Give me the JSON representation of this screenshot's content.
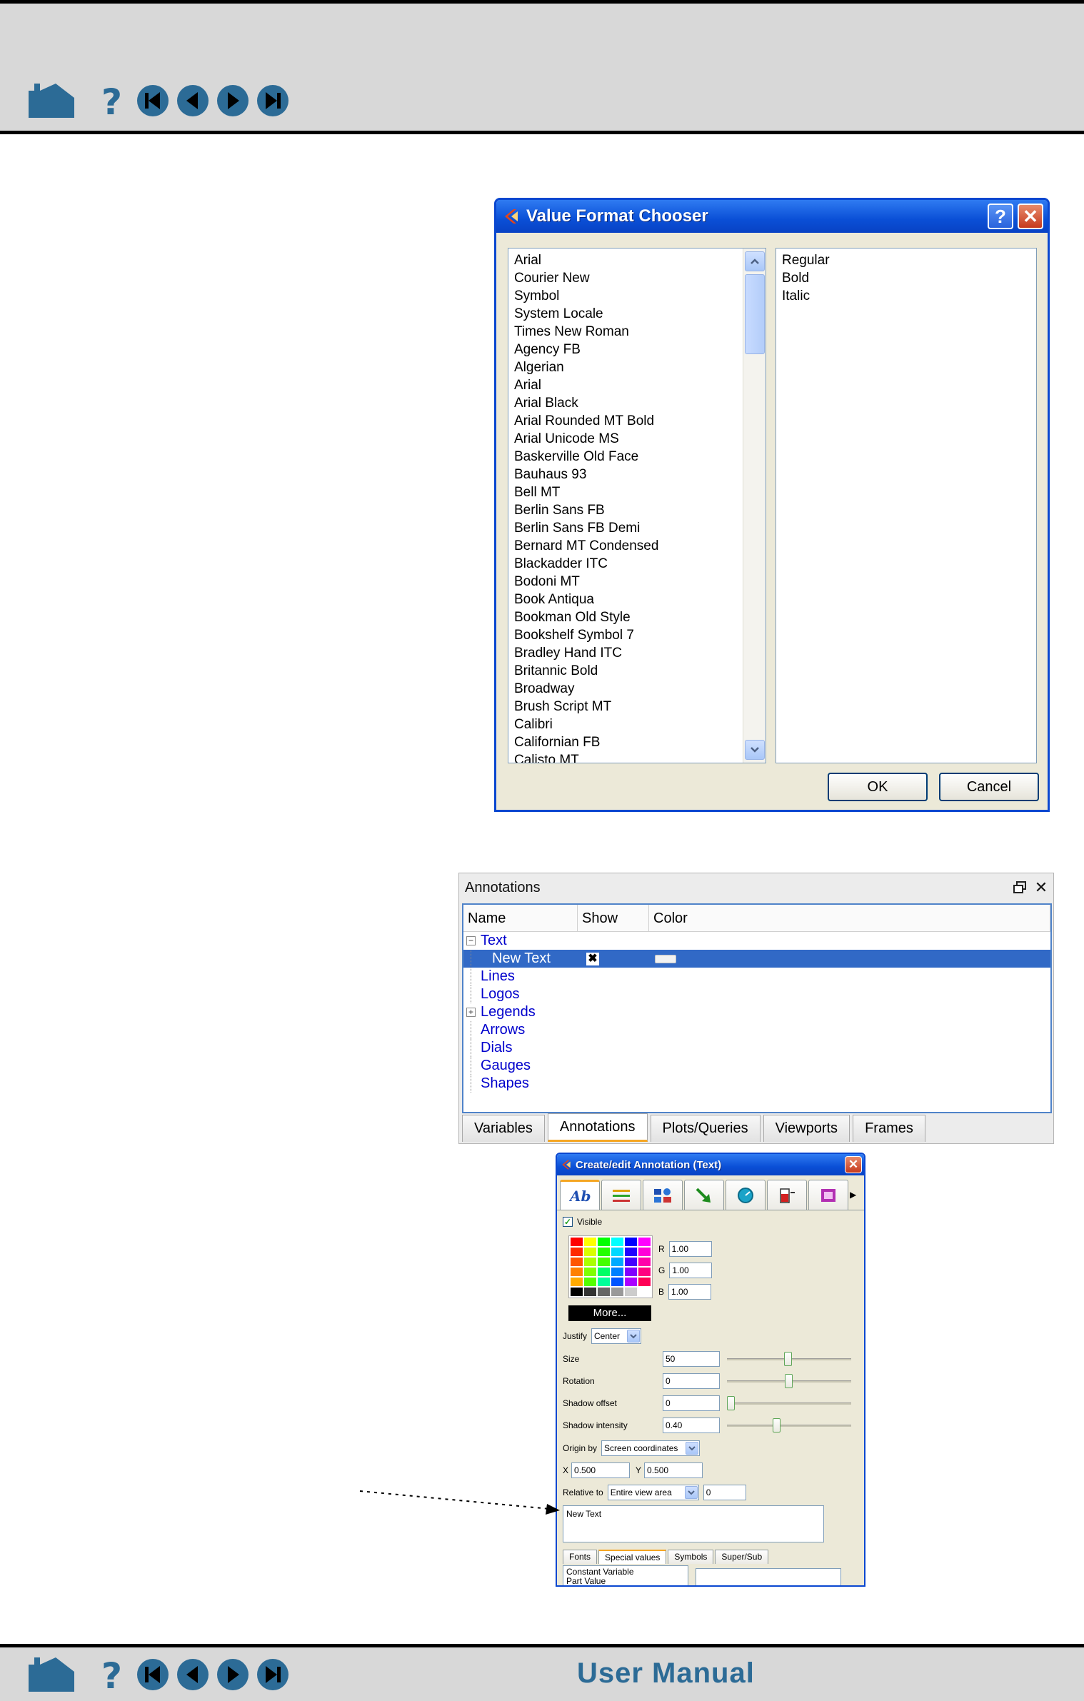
{
  "manual": {
    "footer_title": "User Manual",
    "nav_icons": [
      "home-icon",
      "help-icon",
      "first-page-icon",
      "previous-page-icon",
      "next-page-icon",
      "last-page-icon"
    ],
    "accent_color": "#2c6b96"
  },
  "value_format_chooser": {
    "title": "Value Format Chooser",
    "fonts": [
      "Arial",
      "Courier New",
      "Symbol",
      "System Locale",
      "Times New Roman",
      "Agency FB",
      "Algerian",
      "Arial",
      "Arial Black",
      "Arial Rounded MT Bold",
      "Arial Unicode MS",
      "Baskerville Old Face",
      "Bauhaus 93",
      "Bell MT",
      "Berlin Sans FB",
      "Berlin Sans FB Demi",
      "Bernard MT Condensed",
      "Blackadder ITC",
      "Bodoni MT",
      "Book Antiqua",
      "Bookman Old Style",
      "Bookshelf Symbol 7",
      "Bradley Hand ITC",
      "Britannic Bold",
      "Broadway",
      "Brush Script MT",
      "Calibri",
      "Californian FB",
      "Calisto MT"
    ],
    "styles": [
      "Regular",
      "Bold",
      "Italic"
    ],
    "ok_label": "OK",
    "cancel_label": "Cancel"
  },
  "annotations_panel": {
    "title": "Annotations",
    "columns": [
      "Name",
      "Show",
      "Color"
    ],
    "tree": [
      {
        "label": "Text",
        "expander": "−",
        "level": 0
      },
      {
        "label": "New Text",
        "level": 1,
        "selected": true,
        "show": "✖"
      },
      {
        "label": "Lines",
        "level": 0
      },
      {
        "label": "Logos",
        "level": 0
      },
      {
        "label": "Legends",
        "expander": "+",
        "level": 0
      },
      {
        "label": "Arrows",
        "level": 0
      },
      {
        "label": "Dials",
        "level": 0
      },
      {
        "label": "Gauges",
        "level": 0
      },
      {
        "label": "Shapes",
        "level": 0
      }
    ],
    "tabs": [
      "Variables",
      "Annotations",
      "Plots/Queries",
      "Viewports",
      "Frames"
    ],
    "active_tab": "Annotations"
  },
  "create_edit_dialog": {
    "title": "Create/edit Annotation (Text)",
    "tab_icons": [
      "text-tab-icon",
      "lines-tab-icon",
      "logos-tab-icon",
      "arrows-tab-icon",
      "dials-tab-icon",
      "gauges-tab-icon",
      "shapes-tab-icon"
    ],
    "visible_label": "Visible",
    "visible_checked": "✓",
    "palette_colors": [
      "#ff0000",
      "#ffff00",
      "#00ff00",
      "#00ffff",
      "#0000ff",
      "#ff00ff",
      "#ff2a00",
      "#d9ff00",
      "#22ff00",
      "#00d9ff",
      "#2200ff",
      "#ff00d9",
      "#ff5500",
      "#aaff00",
      "#44ff00",
      "#00aaff",
      "#4400ff",
      "#ff00aa",
      "#ff8000",
      "#80ff00",
      "#00ff66",
      "#0080ff",
      "#8000ff",
      "#ff0080",
      "#ffaa00",
      "#55ff00",
      "#00ff99",
      "#0055ff",
      "#aa00ff",
      "#ff0055",
      "#000000",
      "#333333",
      "#666666",
      "#999999",
      "#cccccc",
      "#ffffff"
    ],
    "more_label": "More...",
    "r_label": "R",
    "r_value": "1.00",
    "g_label": "G",
    "g_value": "1.00",
    "b_label": "B",
    "b_value": "1.00",
    "justify_label": "Justify",
    "justify_value": "Center",
    "size_label": "Size",
    "size_value": "50",
    "rotation_label": "Rotation",
    "rotation_value": "0",
    "shadow_offset_label": "Shadow offset",
    "shadow_offset_value": "0",
    "shadow_intensity_label": "Shadow intensity",
    "shadow_intensity_value": "0.40",
    "origin_label": "Origin by",
    "origin_value": "Screen coordinates",
    "x_label": "X",
    "x_value": "0.500",
    "y_label": "Y",
    "y_value": "0.500",
    "relative_label": "Relative to",
    "relative_value": "Entire view area",
    "relative_num": "0",
    "text_value": "New Text",
    "sub_tabs": [
      "Fonts",
      "Special values",
      "Symbols",
      "Super/Sub"
    ],
    "active_sub_tab": "Special values",
    "special_values": [
      "Constant Variable",
      "Part Value"
    ]
  }
}
